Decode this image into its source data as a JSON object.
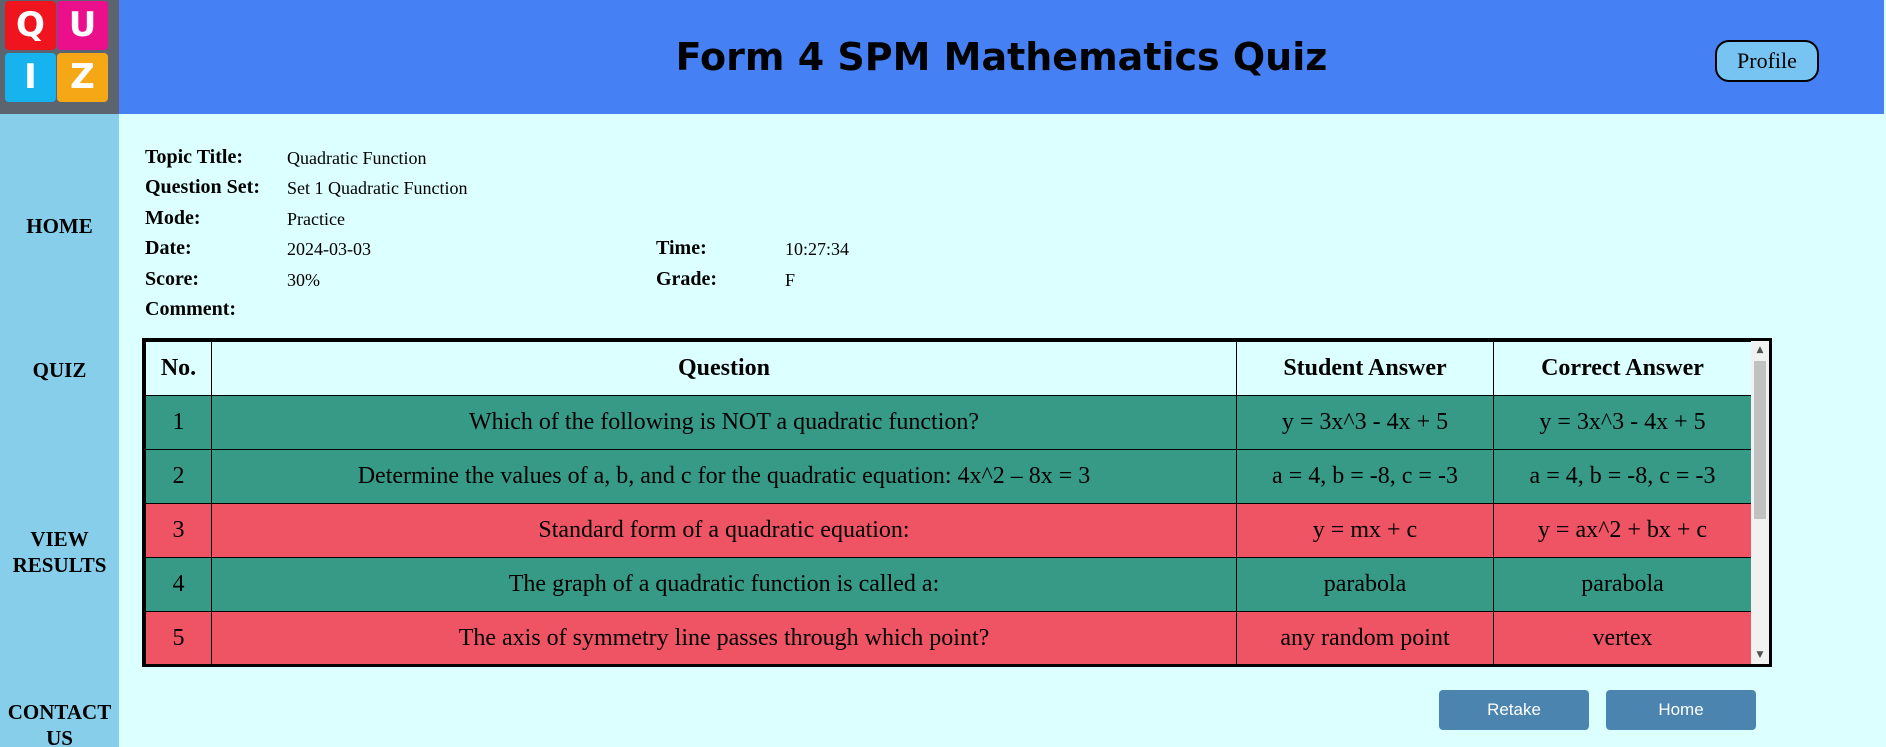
{
  "header": {
    "logo": [
      "Q",
      "U",
      "I",
      "Z"
    ],
    "title": "Form 4 SPM Mathematics Quiz",
    "profile_label": "Profile"
  },
  "sidebar": {
    "items": [
      {
        "label": "HOME"
      },
      {
        "label": "QUIZ"
      },
      {
        "label": "VIEW\nRESULTS"
      },
      {
        "label": "CONTACT\nUS"
      }
    ]
  },
  "info": {
    "topic_label": "Topic Title:",
    "topic_value": "Quadratic Function",
    "set_label": "Question Set:",
    "set_value": "Set 1 Quadratic Function",
    "mode_label": "Mode:",
    "mode_value": "Practice",
    "date_label": "Date:",
    "date_value": "2024-03-03",
    "time_label": "Time:",
    "time_value": "10:27:34",
    "score_label": "Score:",
    "score_value": "30%",
    "grade_label": "Grade:",
    "grade_value": "F",
    "comment_label": "Comment:",
    "comment_value": ""
  },
  "results": {
    "headers": [
      "No.",
      "Question",
      "Student Answer",
      "Correct Answer"
    ],
    "rows": [
      {
        "no": "1",
        "question": "Which of the following is NOT a quadratic function?",
        "student": "y = 3x^3 - 4x + 5",
        "correct": "y = 3x^3 - 4x + 5",
        "status": "correct"
      },
      {
        "no": "2",
        "question": "Determine the values of a, b, and c for the quadratic equation: 4x^2 – 8x = 3",
        "student": "a = 4, b = -8, c = -3",
        "correct": "a = 4, b = -8, c = -3",
        "status": "correct"
      },
      {
        "no": "3",
        "question": "Standard form of a quadratic equation:",
        "student": "y = mx + c",
        "correct": "y = ax^2 + bx + c",
        "status": "wrong"
      },
      {
        "no": "4",
        "question": "The graph of a quadratic function is called a:",
        "student": "parabola",
        "correct": "parabola",
        "status": "correct"
      },
      {
        "no": "5",
        "question": "The axis of symmetry line passes through which point?",
        "student": "any random point",
        "correct": "vertex",
        "status": "wrong"
      }
    ]
  },
  "actions": {
    "retake_label": "Retake",
    "home_label": "Home"
  },
  "colors": {
    "header_bg": "#4580f5",
    "sidebar_bg": "#87ceeb",
    "page_bg": "#dcffff",
    "correct_row": "#379a87",
    "wrong_row": "#ee5464",
    "button_bg": "#4b84ae"
  }
}
